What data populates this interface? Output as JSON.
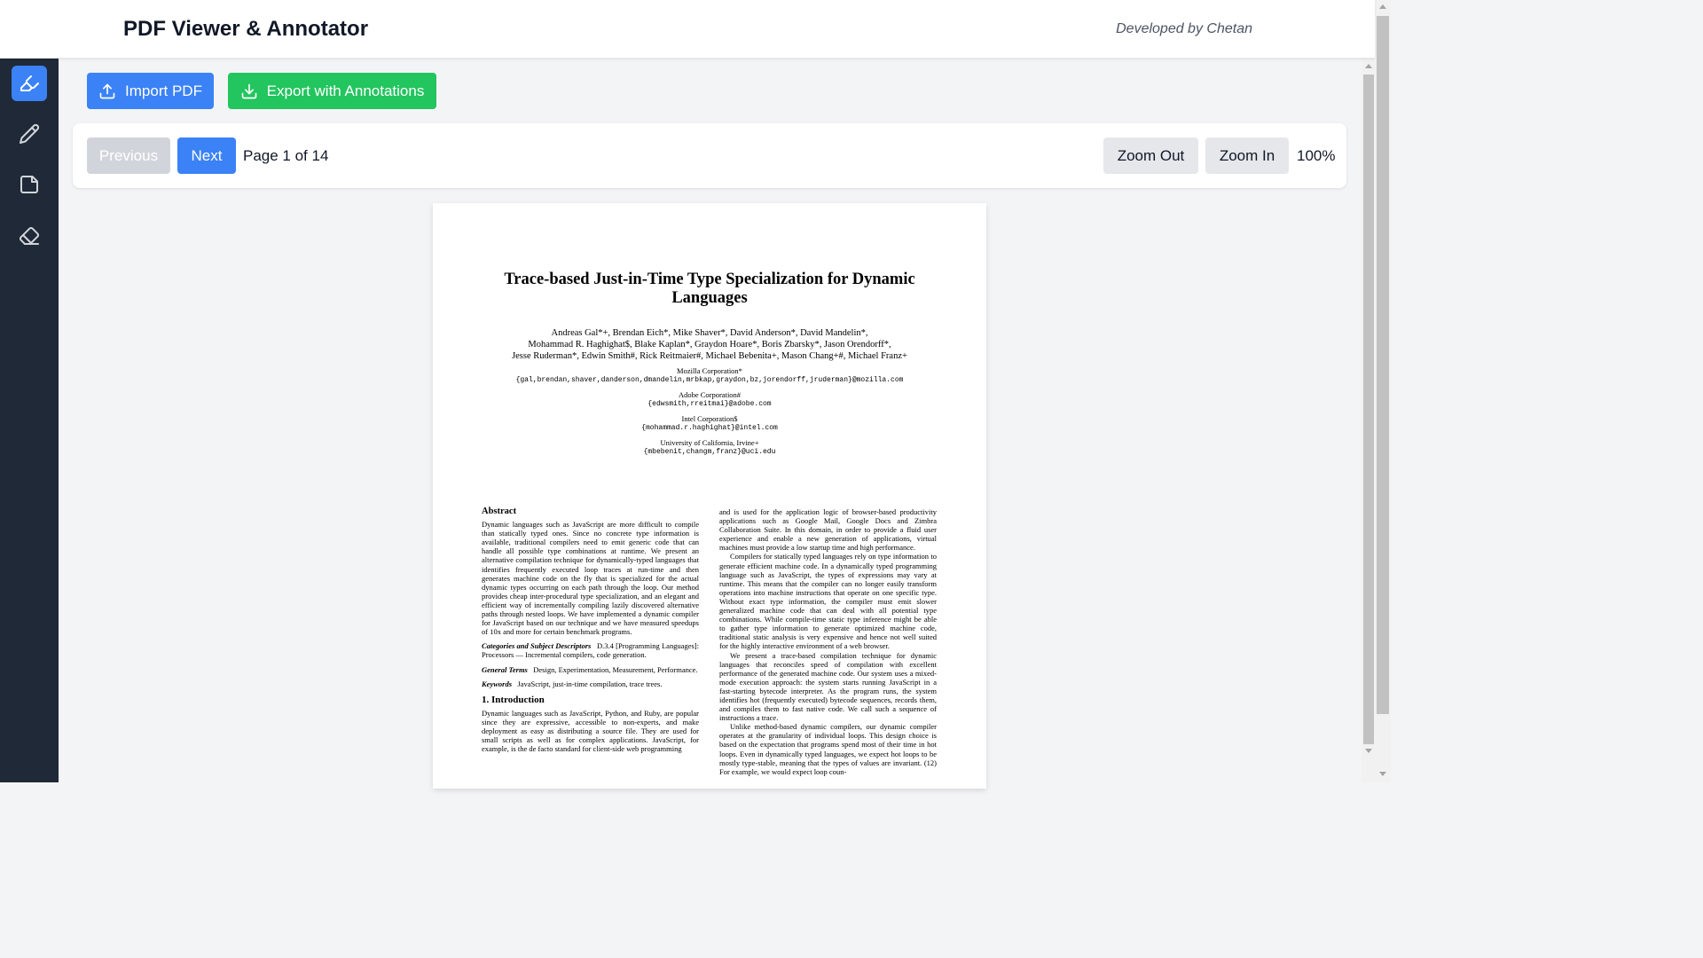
{
  "header": {
    "title": "PDF Viewer & Annotator",
    "credit": "Developed by Chetan"
  },
  "sidebar": {
    "tools": [
      {
        "icon": "highlighter-icon",
        "active": true
      },
      {
        "icon": "pencil-icon",
        "active": false
      },
      {
        "icon": "sticky-note-icon",
        "active": false
      },
      {
        "icon": "eraser-icon",
        "active": false
      }
    ]
  },
  "toolbar": {
    "import_label": "Import PDF",
    "export_label": "Export with Annotations"
  },
  "navigation": {
    "previous_label": "Previous",
    "next_label": "Next",
    "page_info": "Page 1 of 14",
    "zoom_out_label": "Zoom Out",
    "zoom_in_label": "Zoom In",
    "zoom_level": "100%"
  },
  "colors": {
    "primary": "#3b82f6",
    "success": "#22c55e",
    "sidebar_bg": "#1f2937",
    "disabled": "#d1d5db"
  },
  "document": {
    "title": "Trace-based Just-in-Time Type Specialization for Dynamic Languages",
    "authors_line1": "Andreas Gal*+, Brendan Eich*, Mike Shaver*, David Anderson*, David Mandelin*,",
    "authors_line2": "Mohammad R. Haghighat$, Blake Kaplan*, Graydon Hoare*, Boris Zbarsky*, Jason Orendorff*,",
    "authors_line3": "Jesse Ruderman*, Edwin Smith#, Rick Reitmaier#, Michael Bebenita+, Mason Chang+#, Michael Franz+",
    "affiliations": [
      {
        "org": "Mozilla Corporation*",
        "email": "{gal,brendan,shaver,danderson,dmandelin,mrbkap,graydon,bz,jorendorff,jruderman}@mozilla.com"
      },
      {
        "org": "Adobe Corporation#",
        "email": "{edwsmith,rreitmai}@adobe.com"
      },
      {
        "org": "Intel Corporation$",
        "email": "{mohammad.r.haghighat}@intel.com"
      },
      {
        "org": "University of California, Irvine+",
        "email": "{mbebenit,changm,franz}@uci.edu"
      }
    ],
    "abstract_heading": "Abstract",
    "abstract_text": "Dynamic languages such as JavaScript are more difficult to compile than statically typed ones. Since no concrete type information is available, traditional compilers need to emit generic code that can handle all possible type combinations at runtime. We present an alternative compilation technique for dynamically-typed languages that identifies frequently executed loop traces at run-time and then generates machine code on the fly that is specialized for the actual dynamic types occurring on each path through the loop. Our method provides cheap inter-procedural type specialization, and an elegant and efficient way of incrementally compiling lazily discovered alternative paths through nested loops. We have implemented a dynamic compiler for JavaScript based on our technique and we have measured speedups of 10x and more for certain benchmark programs.",
    "categories_label": "Categories and Subject Descriptors",
    "categories_text": "D.3.4 [Programming Languages]: Processors — Incremental compilers, code generation.",
    "terms_label": "General Terms",
    "terms_text": "Design, Experimentation, Measurement, Performance.",
    "keywords_label": "Keywords",
    "keywords_text": "JavaScript, just-in-time compilation, trace trees.",
    "intro_heading": "1.   Introduction",
    "intro_text": "Dynamic languages such as JavaScript, Python, and Ruby, are popular since they are expressive, accessible to non-experts, and make deployment as easy as distributing a source file. They are used for small scripts as well as for complex applications. JavaScript, for example, is the de facto standard for client-side web programming",
    "right_p1": "and is used for the application logic of browser-based productivity applications such as Google Mail, Google Docs and Zimbra Collaboration Suite. In this domain, in order to provide a fluid user experience and enable a new generation of applications, virtual machines must provide a low startup time and high performance.",
    "right_p2": "Compilers for statically typed languages rely on type information to generate efficient machine code. In a dynamically typed programming language such as JavaScript, the types of expressions may vary at runtime. This means that the compiler can no longer easily transform operations into machine instructions that operate on one specific type. Without exact type information, the compiler must emit slower generalized machine code that can deal with all potential type combinations. While compile-time static type inference might be able to gather type information to generate optimized machine code, traditional static analysis is very expensive and hence not well suited for the highly interactive environment of a web browser.",
    "right_p3": "We present a trace-based compilation technique for dynamic languages that reconciles speed of compilation with excellent performance of the generated machine code. Our system uses a mixed-mode execution approach: the system starts running JavaScript in a fast-starting bytecode interpreter. As the program runs, the system identifies hot (frequently executed) bytecode sequences, records them, and compiles them to fast native code. We call such a sequence of instructions a trace.",
    "right_p4": "Unlike method-based dynamic compilers, our dynamic compiler operates at the granularity of individual loops. This design choice is based on the expectation that programs spend most of their time in hot loops. Even in dynamically typed languages, we expect hot loops to be mostly type-stable, meaning that the types of values are invariant. (12) For example, we would expect loop coun-"
  }
}
